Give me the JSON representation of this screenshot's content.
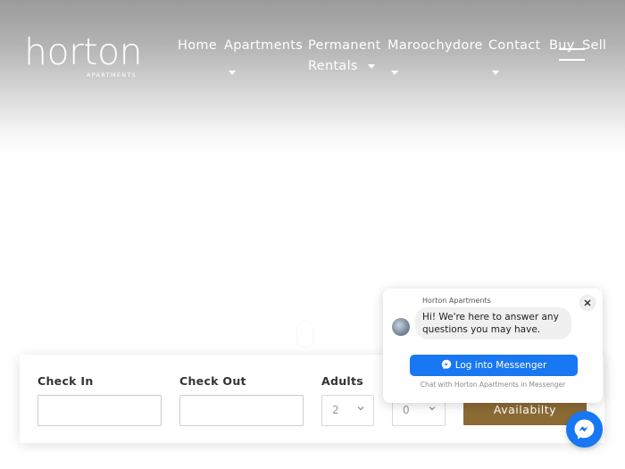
{
  "brand": {
    "name": "horton",
    "tagline": "APARTMENTS"
  },
  "nav": {
    "items": [
      {
        "label": "Home"
      },
      {
        "label": "Apartments"
      },
      {
        "label": "Permanent"
      },
      {
        "label": "Rentals"
      },
      {
        "label": "Maroochydore"
      },
      {
        "label": "Contact"
      },
      {
        "label": "Buy"
      },
      {
        "label": "Sell"
      }
    ]
  },
  "booking": {
    "check_in_label": "Check In",
    "check_out_label": "Check Out",
    "adults_label": "Adults",
    "adults_value": "2",
    "children_value": "0",
    "button_label": "Availabilty"
  },
  "chat": {
    "page_name": "Horton Apartments",
    "greeting": "Hi! We're here to answer any questions you may have.",
    "login_label": "Log into Messenger",
    "footer": "Chat with Horton Apartments in Messenger"
  },
  "colors": {
    "accent": "#8b6a34",
    "messenger": "#1877f2"
  }
}
